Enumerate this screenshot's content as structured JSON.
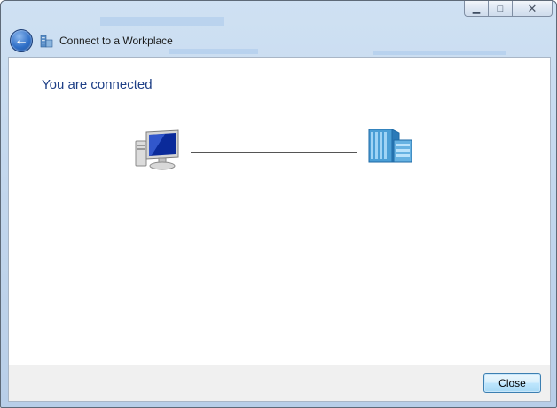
{
  "window": {
    "title": "Connect to a Workplace",
    "caption": {
      "minimize_icon": "minimize-icon",
      "maximize_icon": "maximize-icon",
      "close_icon": "close-icon"
    }
  },
  "header": {
    "back_icon": "back-arrow-icon",
    "title": "Connect to a Workplace"
  },
  "main": {
    "heading": "You are connected",
    "left_icon": "computer-icon",
    "right_icon": "workplace-building-icon"
  },
  "footer": {
    "close_label": "Close"
  },
  "colors": {
    "heading": "#1e3f86",
    "frame": "#c3d7ed",
    "footer": "#f0f0f0",
    "button_border": "#3c7fb1"
  }
}
